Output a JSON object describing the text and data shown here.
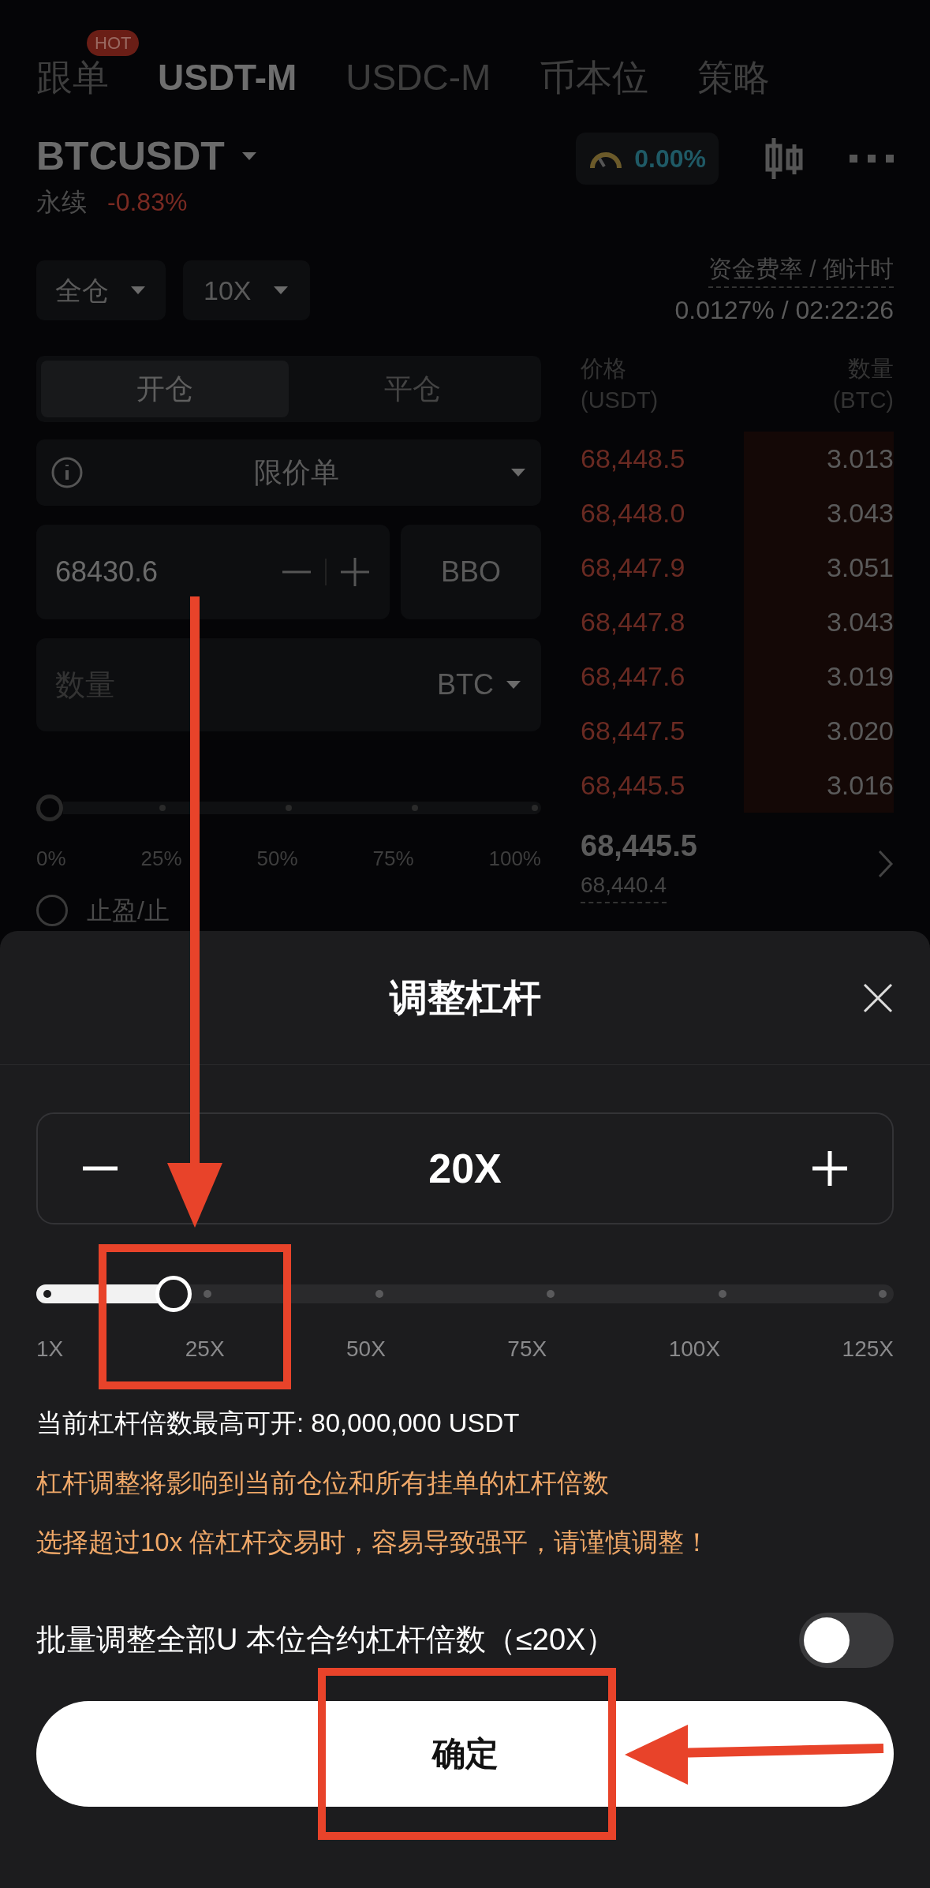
{
  "top_tabs": [
    {
      "label": "跟单",
      "selected": false,
      "badge": "HOT"
    },
    {
      "label": "USDT-M",
      "selected": true
    },
    {
      "label": "USDC-M",
      "selected": false
    },
    {
      "label": "币本位",
      "selected": false
    },
    {
      "label": "策略",
      "selected": false
    }
  ],
  "symbol": {
    "name": "BTCUSDT",
    "type": "永续",
    "change": "-0.83%"
  },
  "sentiment": {
    "value": "0.00%"
  },
  "margin_mode": "全仓",
  "leverage": "10X",
  "funding": {
    "label": "资金费率 / 倒计时",
    "value": "0.0127% / 02:22:26"
  },
  "position_tabs": [
    {
      "label": "开仓",
      "selected": true
    },
    {
      "label": "平仓",
      "selected": false
    }
  ],
  "order_type": "限价单",
  "price": {
    "value": "68430.6"
  },
  "bbo": "BBO",
  "quantity": {
    "placeholder": "数量",
    "unit": "BTC"
  },
  "amount_slider": {
    "level": 0,
    "labels": [
      "0%",
      "25%",
      "50%",
      "75%",
      "100%"
    ]
  },
  "tp_sl": {
    "label": "止盈/止",
    "checked": false
  },
  "order_book": {
    "price_header": [
      "价格",
      "(USDT)"
    ],
    "qty_header": [
      "数量",
      "(BTC)"
    ],
    "asks": [
      {
        "price": "68,448.5",
        "qty": "3.013"
      },
      {
        "price": "68,448.0",
        "qty": "3.043"
      },
      {
        "price": "68,447.9",
        "qty": "3.051"
      },
      {
        "price": "68,447.8",
        "qty": "3.043"
      },
      {
        "price": "68,447.6",
        "qty": "3.019"
      },
      {
        "price": "68,447.5",
        "qty": "3.020"
      },
      {
        "price": "68,445.5",
        "qty": "3.016"
      }
    ],
    "last_price": "68,445.5",
    "mark_price": "68,440.4"
  },
  "sheet": {
    "title": "调整杠杆",
    "value": "20X",
    "slider": {
      "level": 0.16,
      "labels": [
        "1X",
        "25X",
        "50X",
        "75X",
        "100X",
        "125X"
      ]
    },
    "max_info": "当前杠杆倍数最高可开: 80,000,000 USDT",
    "warnings": [
      "杠杆调整将影响到当前仓位和所有挂单的杠杆倍数",
      "选择超过10x 倍杠杆交易时，容易导致强平，请谨慎调整！"
    ],
    "batch": {
      "label": "批量调整全部U 本位合约杠杆倍数（≤20X）",
      "on": false
    },
    "confirm": "确定"
  }
}
